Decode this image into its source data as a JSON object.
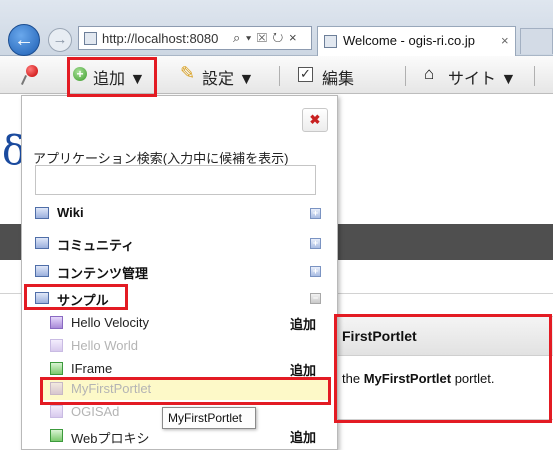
{
  "browser": {
    "back_glyph": "←",
    "forward_glyph": "→",
    "url": "http://localhost:8080",
    "addr_tools": "⌕ ▾ ☒ ↻ ×",
    "tab_title": "Welcome - ogis-ri.co.jp",
    "tab_close": "×"
  },
  "dockbar": {
    "add_label": "追加 ▼",
    "settings_label": "設定 ▼",
    "edit_label": "編集",
    "site_label": "サイト ▼",
    "plus_glyph": "+",
    "pencil_glyph": "✎",
    "check_glyph": "✓",
    "home_glyph": "⌂",
    "icons": [
      "pin-icon",
      "add-icon",
      "pencil-icon",
      "checkbox-icon",
      "home-icon"
    ]
  },
  "page": {
    "logo_fragment": "δ",
    "portlet_title": "FirstPortlet",
    "portlet_text_prefix": "the ",
    "portlet_text_bold": "MyFirstPortlet",
    "portlet_text_suffix": " portlet."
  },
  "add_menu": {
    "close_glyph": "✖",
    "search_label": "アプリケーション検索(入力中に候補を表示)",
    "search_value": "",
    "categories": [
      {
        "label": "Wiki",
        "toggle": "+"
      },
      {
        "label": "コミュニティ",
        "toggle": "+"
      },
      {
        "label": "コンテンツ管理",
        "toggle": "+"
      },
      {
        "label": "サンプル",
        "toggle": "−"
      }
    ],
    "apps": [
      {
        "label": "Hello Velocity",
        "add": "追加",
        "disabled": false
      },
      {
        "label": "Hello World",
        "add": "",
        "disabled": true
      },
      {
        "label": "IFrame",
        "add": "追加",
        "disabled": false
      },
      {
        "label": "MyFirstPortlet",
        "add": "",
        "disabled": true
      },
      {
        "label": "OGISAd",
        "add": "",
        "disabled": true
      },
      {
        "label": "Webプロキシ",
        "add": "追加",
        "disabled": false
      }
    ]
  },
  "tooltip": {
    "text": "MyFirstPortlet"
  },
  "colors": {
    "annotation_red": "#e31b23",
    "highlight_row": "#fdf9c8",
    "dockbar_bg": "#efefef"
  }
}
